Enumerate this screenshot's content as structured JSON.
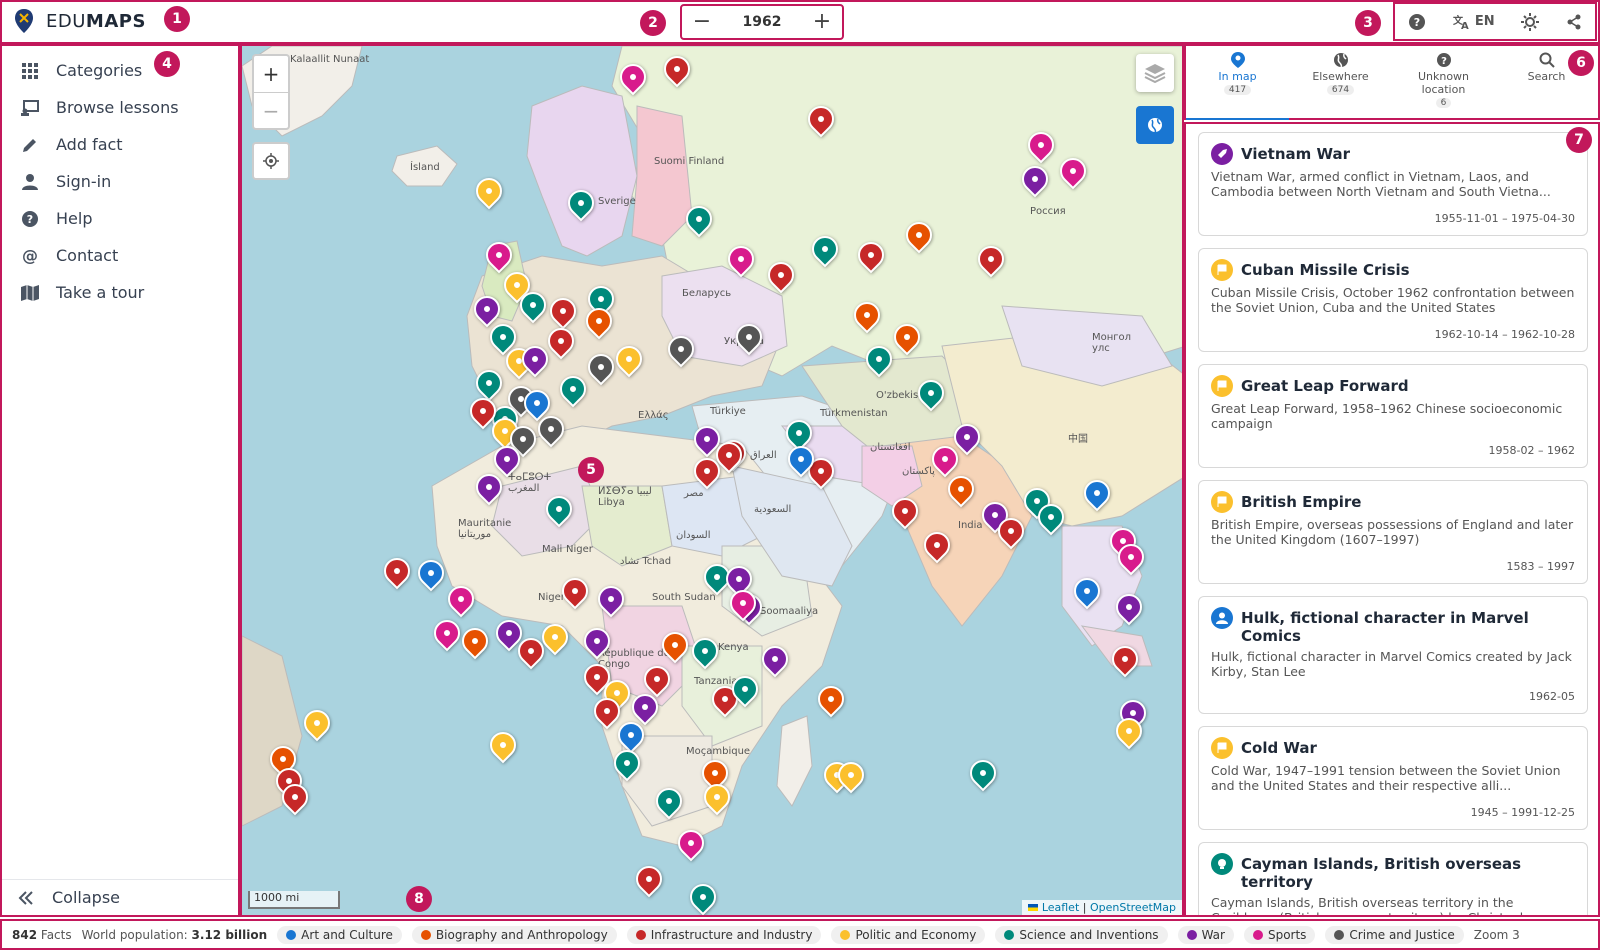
{
  "app": {
    "logo_text_light": "EDU",
    "logo_text_bold": "MAPS"
  },
  "timeline": {
    "year": "1962",
    "minus": "−",
    "plus": "+"
  },
  "header_tools": {
    "language": "EN"
  },
  "sidebar": {
    "items": [
      {
        "label": "Categories",
        "icon": "grid-icon"
      },
      {
        "label": "Browse lessons",
        "icon": "lessons-icon"
      },
      {
        "label": "Add fact",
        "icon": "pencil-icon"
      },
      {
        "label": "Sign-in",
        "icon": "person-icon"
      },
      {
        "label": "Help",
        "icon": "help-icon"
      },
      {
        "label": "Contact",
        "icon": "at-icon"
      },
      {
        "label": "Take a tour",
        "icon": "map-icon"
      }
    ],
    "collapse_label": "Collapse"
  },
  "map": {
    "scale_label": "1000 mi",
    "attribution_leaflet": "Leaflet",
    "attribution_osm": "OpenStreetMap",
    "labels": [
      "Kalaallit Nunaat",
      "Ísland",
      "Sverige",
      "Suomi Finland",
      "Беларусь",
      "Україна",
      "Россия",
      "O'zbekiston",
      "Türkmenistan",
      "Türkiye",
      "Ελλάς",
      "ⵍⵉⴱⵢⴰ ليبيا Libya",
      "مصر",
      "السعودية",
      "العراق",
      "افغانستان",
      "پاکستان",
      "India",
      "中国",
      "Монгол улс",
      "Mauritanie موريتانيا",
      "Mali",
      "Niger",
      "تشاد Tchad",
      "السودان",
      "South Sudan",
      "Soomaaliya",
      "Kenya",
      "Tanzania",
      "Moçambique",
      "Nigeria",
      "République du Congo",
      "ⵜⴰⵎⵓⵔⵜ المغرب"
    ]
  },
  "tabs": [
    {
      "label": "In map",
      "count": "417",
      "icon": "pin-icon"
    },
    {
      "label": "Elsewhere",
      "count": "674",
      "icon": "globe-icon"
    },
    {
      "label": "Unknown location",
      "count": "6",
      "icon": "question-icon"
    },
    {
      "label": "Search",
      "count": "",
      "icon": "search-icon"
    }
  ],
  "facts": [
    {
      "title": "Vietnam War",
      "desc": "Vietnam War, armed conflict in Vietnam, Laos, and Cambodia between North Vietnam and South Vietna...",
      "date": "1955-11-01 – 1975-04-30",
      "color": "#7b1fa2",
      "icon": "rocket-icon"
    },
    {
      "title": "Cuban Missile Crisis",
      "desc": "Cuban Missile Crisis, October 1962 confrontation between the Soviet Union, Cuba and the United States",
      "date": "1962-10-14 – 1962-10-28",
      "color": "#fbc02d",
      "icon": "flag-icon"
    },
    {
      "title": "Great Leap Forward",
      "desc": "Great Leap Forward, 1958–1962 Chinese socioeconomic campaign",
      "date": "1958-02 – 1962",
      "color": "#fbc02d",
      "icon": "flag-icon"
    },
    {
      "title": "British Empire",
      "desc": "British Empire, overseas possessions of England and later the United Kingdom (1607–1997)",
      "date": "1583 – 1997",
      "color": "#fbc02d",
      "icon": "flag-icon"
    },
    {
      "title": "Hulk, fictional character in Marvel Comics",
      "desc": "Hulk, fictional character in Marvel Comics created by Jack Kirby, Stan Lee",
      "date": "1962-05",
      "color": "#1976d2",
      "icon": "person-icon"
    },
    {
      "title": "Cold War",
      "desc": "Cold War, 1947–1991 tension between the Soviet Union and the United States and their respective alli...",
      "date": "1945 – 1991-12-25",
      "color": "#fbc02d",
      "icon": "flag-icon"
    },
    {
      "title": "Cayman Islands, British overseas territory",
      "desc": "Cayman Islands, British overseas territory in the Caribbean (British overseas territory) by Christopher...",
      "date": "",
      "color": "#00897b",
      "icon": "bulb-icon"
    }
  ],
  "footer": {
    "facts_count": "842",
    "facts_label": "Facts",
    "population_label": "World population:",
    "population_value": "3.12 billion",
    "categories": [
      {
        "label": "Art and Culture",
        "color": "#1976d2"
      },
      {
        "label": "Biography and Anthropology",
        "color": "#e65100"
      },
      {
        "label": "Infrastructure and Industry",
        "color": "#c62828"
      },
      {
        "label": "Politic and Economy",
        "color": "#fbc02d"
      },
      {
        "label": "Science and Inventions",
        "color": "#00897b"
      },
      {
        "label": "War",
        "color": "#7b1fa2"
      },
      {
        "label": "Sports",
        "color": "#d81b8c"
      },
      {
        "label": "Crime and Justice",
        "color": "#555555"
      }
    ],
    "zoom_label": "Zoom 3"
  },
  "annotations": [
    "1",
    "2",
    "3",
    "4",
    "5",
    "6",
    "7",
    "8"
  ]
}
